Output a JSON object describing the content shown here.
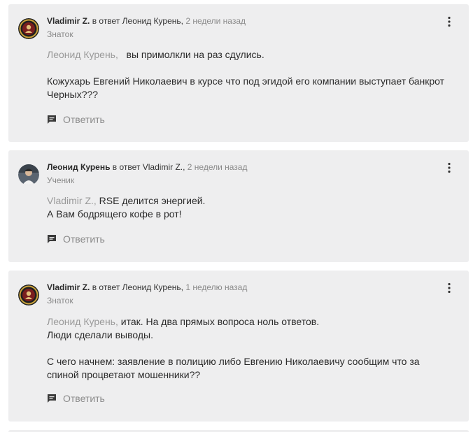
{
  "comments": [
    {
      "author": "Vladimir Z.",
      "reply_prefix": " в ответ ",
      "reply_to": "Леонид Курень",
      "separator": ", ",
      "time": "2 недели назад",
      "rank": "Знаток",
      "mention": "Леонид Курень,",
      "line1": "   вы примолкли на раз сдулись.",
      "line2": "Кожухарь Евгений Николаевич в курсе что под эгидой его компании выступает банкрот",
      "line3": "Черных???",
      "reply_label": "Ответить"
    },
    {
      "author": "Леонид Курень",
      "reply_prefix": " в ответ ",
      "reply_to": "Vladimir Z.",
      "separator": ", ",
      "time": "2 недели назад",
      "rank": "Ученик",
      "mention": "Vladimir Z.,",
      "line1": " RSE делится энергией.",
      "line2": "А Вам бодрящего кофе в рот!",
      "reply_label": "Ответить"
    },
    {
      "author": "Vladimir Z.",
      "reply_prefix": " в ответ ",
      "reply_to": "Леонид Курень",
      "separator": ", ",
      "time": "1 неделю назад",
      "rank": "Знаток",
      "mention": "Леонид Курень,",
      "line1": " итак. На два прямых вопроса ноль ответов.",
      "line2": "Люди сделали выводы.",
      "line3": "С чего начнем: заявление в полицию либо Евгению Николаевичу сообщим что за",
      "line4": "спиной процветают мошенники??",
      "reply_label": "Ответить"
    }
  ],
  "colors": {
    "card_bg": "#eeeeef",
    "muted": "#8a8a8a",
    "text": "#2b2b2b"
  },
  "icons": {
    "menu": "kebab-menu-icon",
    "reply": "comment-bubble-icon"
  }
}
